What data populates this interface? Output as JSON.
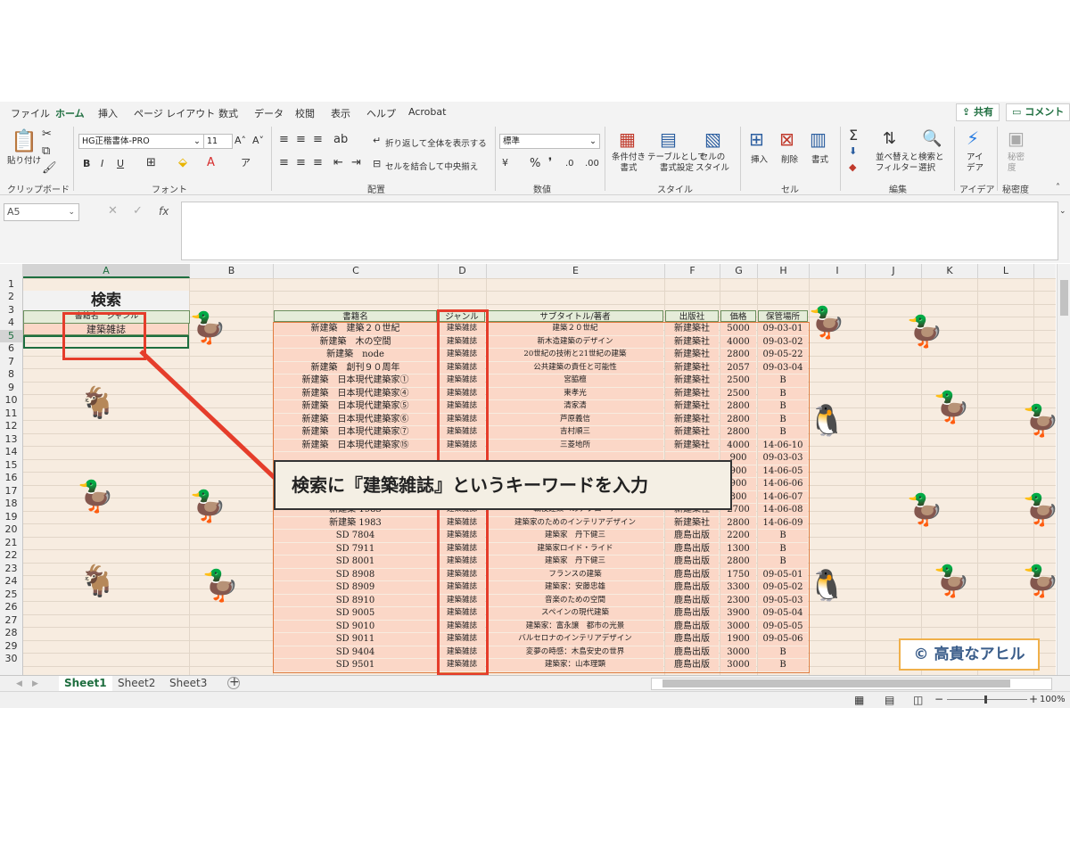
{
  "menu": {
    "tabs": [
      "ファイル",
      "ホーム",
      "挿入",
      "ページ レイアウト",
      "数式",
      "データ",
      "校閲",
      "表示",
      "ヘルプ",
      "Acrobat"
    ],
    "share_label": "共有",
    "comment_label": "コメント"
  },
  "ribbon": {
    "clipboard": {
      "paste": "貼り付け",
      "group": "クリップボード"
    },
    "font": {
      "name": "HG正楷書体-PRO",
      "size": "11",
      "group": "フォント",
      "bold": "B",
      "italic": "I",
      "underline": "U"
    },
    "alignment": {
      "wrap": "折り返して全体を表示する",
      "merge": "セルを結合して中央揃え",
      "group": "配置"
    },
    "number": {
      "format": "標準",
      "group": "数値",
      "percent": "%"
    },
    "styles": {
      "conditional": "条件付き\n書式",
      "table": "テーブルとして\n書式設定",
      "cell": "セルの\nスタイル",
      "group": "スタイル"
    },
    "cells": {
      "insert": "挿入",
      "delete": "削除",
      "format": "書式",
      "group": "セル"
    },
    "editing": {
      "sort": "並べ替えと\nフィルター",
      "find": "検索と\n選択",
      "group": "編集",
      "sigma": "Σ"
    },
    "ideas": {
      "label": "アイ\nデア",
      "group": "アイデア"
    },
    "sensitivity": {
      "label": "秘密\n度",
      "group": "秘密度"
    }
  },
  "formula_bar": {
    "name_box": "A5",
    "fx": "fx",
    "value": ""
  },
  "columns": [
    "A",
    "B",
    "C",
    "D",
    "E",
    "F",
    "G",
    "H",
    "I",
    "J",
    "K",
    "L"
  ],
  "rows": [
    "1",
    "2",
    "3",
    "4",
    "5",
    "6",
    "7",
    "8",
    "9",
    "10",
    "11",
    "12",
    "13",
    "14",
    "15",
    "16",
    "17",
    "18",
    "19",
    "20",
    "21",
    "22",
    "23",
    "24",
    "25",
    "26",
    "27",
    "28",
    "29",
    "30"
  ],
  "search": {
    "title": "検索",
    "header": "書籍名　ジャンル",
    "keyword": "建築雑誌"
  },
  "table": {
    "headers": [
      "書籍名",
      "ジャンル",
      "サブタイトル/著者",
      "出版社",
      "価格",
      "保管場所"
    ],
    "rows": [
      [
        "新建築　建築２０世紀",
        "建築雑誌",
        "建築２０世紀",
        "新建築社",
        "5000",
        "09-03-01"
      ],
      [
        "新建築　木の空間",
        "建築雑誌",
        "新木造建築のデザイン",
        "新建築社",
        "4000",
        "09-03-02"
      ],
      [
        "新建築　node",
        "建築雑誌",
        "20世紀の技術と21世紀の建築",
        "新建築社",
        "2800",
        "09-05-22"
      ],
      [
        "新建築　創刊９０周年",
        "建築雑誌",
        "公共建築の責任と可能性",
        "新建築社",
        "2057",
        "09-03-04"
      ],
      [
        "新建築　日本現代建築家①",
        "建築雑誌",
        "宮脇檀",
        "新建築社",
        "2500",
        "B"
      ],
      [
        "新建築　日本現代建築家④",
        "建築雑誌",
        "東孝光",
        "新建築社",
        "2500",
        "B"
      ],
      [
        "新建築　日本現代建築家⑤",
        "建築雑誌",
        "清家清",
        "新建築社",
        "2800",
        "B"
      ],
      [
        "新建築　日本現代建築家⑥",
        "建築雑誌",
        "芦原義信",
        "新建築社",
        "2800",
        "B"
      ],
      [
        "新建築　日本現代建築家⑦",
        "建築雑誌",
        "吉村順三",
        "新建築社",
        "2800",
        "B"
      ],
      [
        "新建築　日本現代建築家⑮",
        "建築雑誌",
        "三菱地所",
        "新建築社",
        "4000",
        "14-06-10"
      ],
      [
        "",
        "",
        "",
        "",
        "900",
        "09-03-03"
      ],
      [
        "",
        "",
        "",
        "",
        "900",
        "14-06-05"
      ],
      [
        "",
        "",
        "",
        "",
        "900",
        "14-06-06"
      ],
      [
        "",
        "",
        "",
        "",
        "800",
        "14-06-07"
      ],
      [
        "新建築 1983",
        "建築雑誌",
        "戦後建築へのアプローチ",
        "新建築社",
        "2700",
        "14-06-08"
      ],
      [
        "新建築 1983",
        "建築雑誌",
        "建築家のためのインテリアデザイン",
        "新建築社",
        "2800",
        "14-06-09"
      ],
      [
        "SD 7804",
        "建築雑誌",
        "建築家　丹下健三",
        "鹿島出版",
        "2200",
        "B"
      ],
      [
        "SD 7911",
        "建築雑誌",
        "建築家ロイド・ライド",
        "鹿島出版",
        "1300",
        "B"
      ],
      [
        "SD 8001",
        "建築雑誌",
        "建築家　丹下健三",
        "鹿島出版",
        "2800",
        "B"
      ],
      [
        "SD 8908",
        "建築雑誌",
        "フランスの建築",
        "鹿島出版",
        "1750",
        "09-05-01"
      ],
      [
        "SD 8909",
        "建築雑誌",
        "建築家：安藤忠雄",
        "鹿島出版",
        "3300",
        "09-05-02"
      ],
      [
        "SD 8910",
        "建築雑誌",
        "音楽のための空間",
        "鹿島出版",
        "2300",
        "09-05-03"
      ],
      [
        "SD 9005",
        "建築雑誌",
        "スペインの現代建築",
        "鹿島出版",
        "3900",
        "09-05-04"
      ],
      [
        "SD 9010",
        "建築雑誌",
        "建築家：富永譲　都市の光景",
        "鹿島出版",
        "3000",
        "09-05-05"
      ],
      [
        "SD 9011",
        "建築雑誌",
        "バルセロナのインテリアデザイン",
        "鹿島出版",
        "1900",
        "09-05-06"
      ],
      [
        "SD 9404",
        "建築雑誌",
        "変夢の時感：木島安史の世界",
        "鹿島出版",
        "3000",
        "B"
      ],
      [
        "SD 9501",
        "建築雑誌",
        "建築家：山本理顕",
        "鹿島出版",
        "3000",
        "B"
      ]
    ]
  },
  "callout": "検索に『建築雑誌』というキーワードを入力",
  "credit": "© 高貴なアヒル",
  "sheet_tabs": [
    "Sheet1",
    "Sheet2",
    "Sheet3"
  ],
  "add_sheet": "+",
  "status": {
    "zoom": "100%"
  },
  "colors": {
    "accent": "#1e6e3f",
    "highlight": "#e53d2b",
    "table_border": "#e07b3f",
    "row_fill": "#fbd7c7",
    "sheet_bg": "#f7ece0"
  }
}
